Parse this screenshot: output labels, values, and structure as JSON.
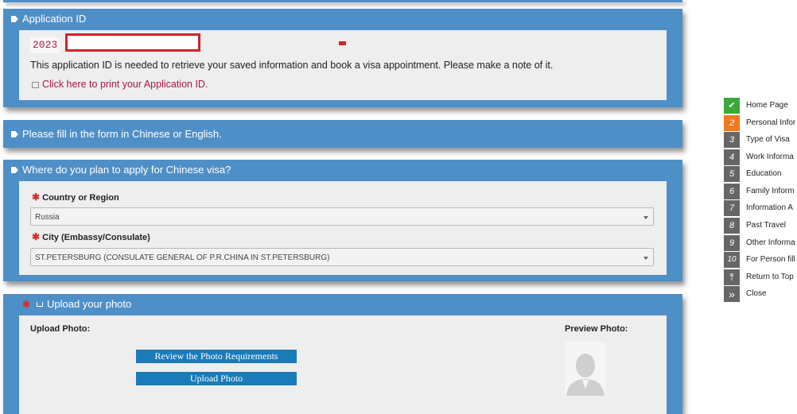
{
  "app_id_panel": {
    "title": "Application ID",
    "id_prefix": "2023",
    "note": "This application ID is needed to retrieve your saved information and book a visa appointment. Please make a note of it.",
    "print_link": "Click here to print your Application ID."
  },
  "language_panel": {
    "title": "Please fill in the form in Chinese or English."
  },
  "location_panel": {
    "title": "Where do you plan to apply for Chinese visa?",
    "required_mark": "✱",
    "country_label": "Country or Region",
    "country_value": "Russia",
    "city_label": "City (Embassy/Consulate)",
    "city_value": "ST.PETERSBURG (CONSULATE GENERAL OF P.R.CHINA IN ST.PETERSBURG)"
  },
  "photo_panel": {
    "title": "Upload your photo",
    "required_mark": "✱",
    "upload_label": "Upload Photo:",
    "preview_label": "Preview Photo:",
    "review_button": "Review the Photo Requirements",
    "upload_button": "Upload Photo"
  },
  "sidebar": {
    "items": [
      {
        "num": "✔",
        "label": "Home Page",
        "color": "#3aa83a"
      },
      {
        "num": "2",
        "label": "Personal Infor",
        "color": "#f07a1a"
      },
      {
        "num": "3",
        "label": "Type of Visa",
        "color": "#666666"
      },
      {
        "num": "4",
        "label": "Work Informa",
        "color": "#666666"
      },
      {
        "num": "5",
        "label": "Education",
        "color": "#666666"
      },
      {
        "num": "6",
        "label": "Family Inform",
        "color": "#666666"
      },
      {
        "num": "7",
        "label": "Information A",
        "color": "#666666"
      },
      {
        "num": "8",
        "label": "Past Travel",
        "color": "#666666"
      },
      {
        "num": "9",
        "label": "Other Informa",
        "color": "#666666"
      },
      {
        "num": "10",
        "label": "For Person fill",
        "color": "#666666"
      },
      {
        "num": "⤒",
        "label": "Return to Top",
        "color": "#666666"
      },
      {
        "num": "»",
        "label": "Close",
        "color": "#666666"
      }
    ]
  }
}
